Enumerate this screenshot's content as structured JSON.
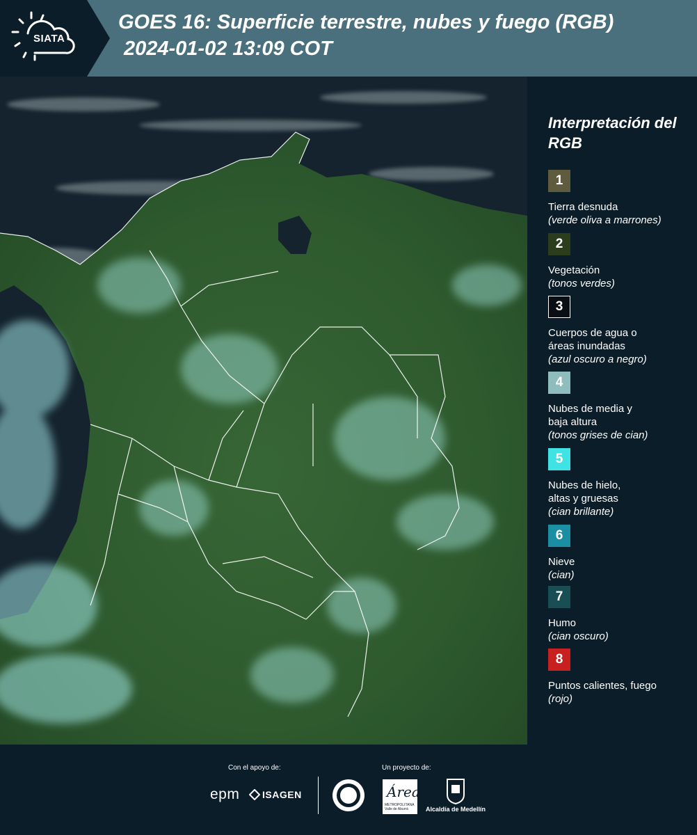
{
  "header": {
    "logo_text": "SIATA",
    "title_line1": "GOES 16: Superficie terrestre, nubes y fuego (RGB)",
    "title_line2": "2024-01-02 13:09 COT"
  },
  "legend": {
    "title": "Interpretación del RGB",
    "items": [
      {
        "number": "1",
        "label": "Tierra desnuda",
        "desc": "(verde oliva a marrones)",
        "color": "#5e5b3f",
        "text_color": "#ffffff"
      },
      {
        "number": "2",
        "label": "Vegetación",
        "desc": "(tonos verdes)",
        "color": "#2c3d1e",
        "text_color": "#ffffff"
      },
      {
        "number": "3",
        "label": "Cuerpos de agua o\náreas inundadas",
        "desc": "(azul oscuro a negro)",
        "color": "#0a0f14",
        "text_color": "#ffffff"
      },
      {
        "number": "4",
        "label": "Nubes de media y\nbaja altura",
        "desc": "(tonos grises de cian)",
        "color": "#8fbcbc",
        "text_color": "#ffffff"
      },
      {
        "number": "5",
        "label": "Nubes de hielo,\naltas y gruesas",
        "desc": "(cian brillante)",
        "color": "#3fe3e3",
        "text_color": "#ffffff"
      },
      {
        "number": "6",
        "label": "Nieve",
        "desc": "(cian)",
        "color": "#1a8ea3",
        "text_color": "#ffffff"
      },
      {
        "number": "7",
        "label": "Humo",
        "desc": "(cian oscuro)",
        "color": "#1a4e55",
        "text_color": "#ffffff"
      },
      {
        "number": "8",
        "label": "Puntos calientes, fuego",
        "desc": "(rojo)",
        "color": "#c8201e",
        "text_color": "#ffffff"
      }
    ]
  },
  "footer": {
    "support_label": "Con el apoyo de:",
    "project_label": "Un proyecto de:",
    "epm": "epm",
    "isagen": "ISAGEN",
    "area_script": "Área",
    "area_small": "METROPOLITANA\nValle de Aburrá",
    "alcaldia": "Alcaldía de Medellín"
  },
  "colors": {
    "header_bg": "#4a6f7d",
    "logo_bg": "#0c1d2a",
    "page_bg": "#0c1d2a",
    "ocean": "#14232e",
    "land": "#2e5a2e",
    "cloud": "#9fe3e3",
    "border": "#ffffff"
  }
}
